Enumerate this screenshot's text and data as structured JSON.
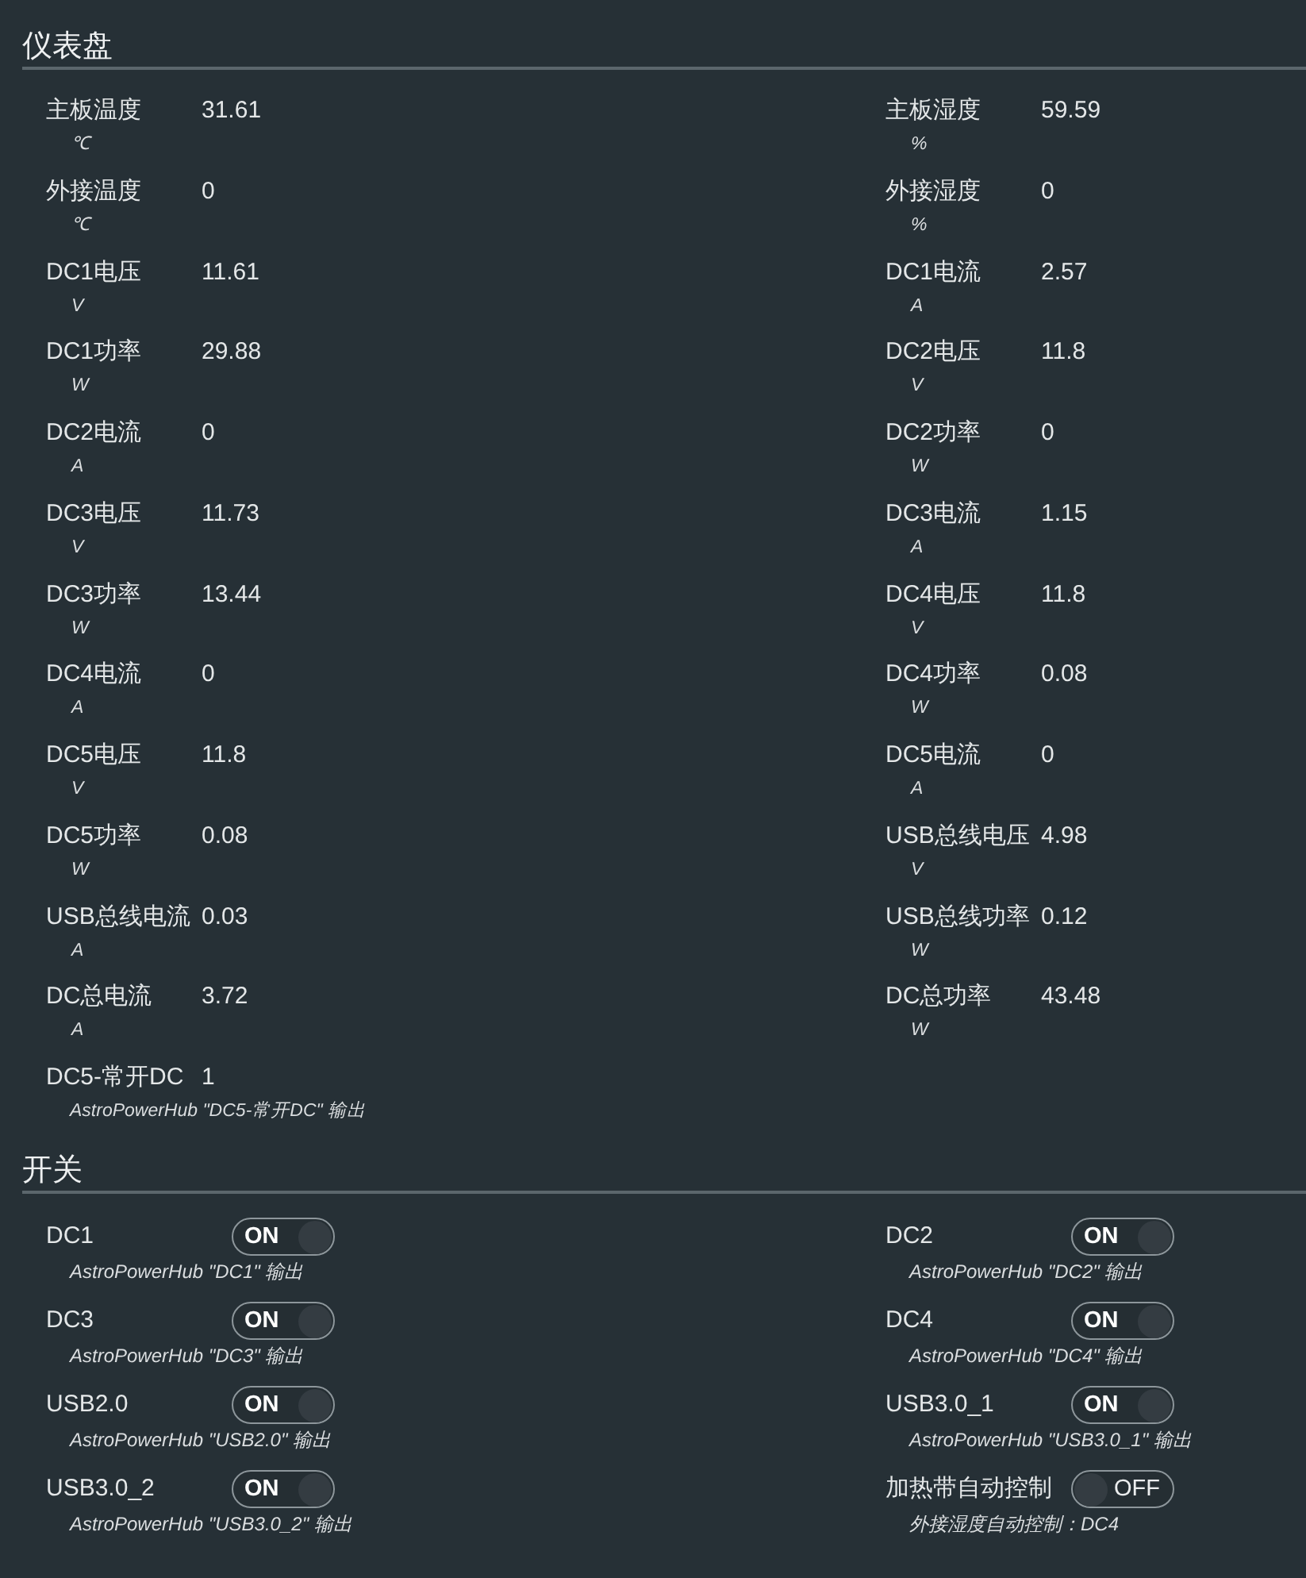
{
  "dashboard": {
    "title": "仪表盘",
    "readings": [
      {
        "label": "主板温度",
        "value": "31.61",
        "unit": "℃"
      },
      {
        "label": "主板湿度",
        "value": "59.59",
        "unit": "%"
      },
      {
        "label": "外接温度",
        "value": "0",
        "unit": "℃"
      },
      {
        "label": "外接湿度",
        "value": "0",
        "unit": "%"
      },
      {
        "label": "DC1电压",
        "value": "11.61",
        "unit": "V"
      },
      {
        "label": "DC1电流",
        "value": "2.57",
        "unit": "A"
      },
      {
        "label": "DC1功率",
        "value": "29.88",
        "unit": "W"
      },
      {
        "label": "DC2电压",
        "value": "11.8",
        "unit": "V"
      },
      {
        "label": "DC2电流",
        "value": "0",
        "unit": "A"
      },
      {
        "label": "DC2功率",
        "value": "0",
        "unit": "W"
      },
      {
        "label": "DC3电压",
        "value": "11.73",
        "unit": "V"
      },
      {
        "label": "DC3电流",
        "value": "1.15",
        "unit": "A"
      },
      {
        "label": "DC3功率",
        "value": "13.44",
        "unit": "W"
      },
      {
        "label": "DC4电压",
        "value": "11.8",
        "unit": "V"
      },
      {
        "label": "DC4电流",
        "value": "0",
        "unit": "A"
      },
      {
        "label": "DC4功率",
        "value": "0.08",
        "unit": "W"
      },
      {
        "label": "DC5电压",
        "value": "11.8",
        "unit": "V"
      },
      {
        "label": "DC5电流",
        "value": "0",
        "unit": "A"
      },
      {
        "label": "DC5功率",
        "value": "0.08",
        "unit": "W"
      },
      {
        "label": "USB总线电压",
        "value": "4.98",
        "unit": "V"
      },
      {
        "label": "USB总线电流",
        "value": "0.03",
        "unit": "A"
      },
      {
        "label": "USB总线功率",
        "value": "0.12",
        "unit": "W"
      },
      {
        "label": "DC总电流",
        "value": "3.72",
        "unit": "A"
      },
      {
        "label": "DC总功率",
        "value": "43.48",
        "unit": "W"
      },
      {
        "label": "DC5-常开DC",
        "value": "1",
        "description": "AstroPowerHub \"DC5-常开DC\" 输出"
      }
    ]
  },
  "switches": {
    "title": "开关",
    "items": [
      {
        "label": "DC1",
        "on": true,
        "state_text": "ON",
        "description": "AstroPowerHub \"DC1\" 输出"
      },
      {
        "label": "DC2",
        "on": true,
        "state_text": "ON",
        "description": "AstroPowerHub \"DC2\" 输出"
      },
      {
        "label": "DC3",
        "on": true,
        "state_text": "ON",
        "description": "AstroPowerHub \"DC3\" 输出"
      },
      {
        "label": "DC4",
        "on": true,
        "state_text": "ON",
        "description": "AstroPowerHub \"DC4\" 输出"
      },
      {
        "label": "USB2.0",
        "on": true,
        "state_text": "ON",
        "description": "AstroPowerHub \"USB2.0\" 输出"
      },
      {
        "label": "USB3.0_1",
        "on": true,
        "state_text": "ON",
        "description": "AstroPowerHub \"USB3.0_1\" 输出"
      },
      {
        "label": "USB3.0_2",
        "on": true,
        "state_text": "ON",
        "description": "AstroPowerHub \"USB3.0_2\" 输出"
      },
      {
        "label": "加热带自动控制",
        "on": false,
        "state_text": "OFF",
        "description": "外接湿度自动控制：DC4"
      }
    ]
  }
}
